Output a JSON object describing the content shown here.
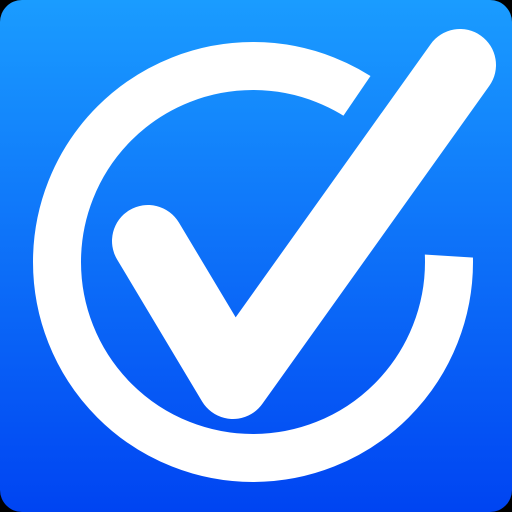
{
  "icon": {
    "name": "check-circle-icon",
    "colors": {
      "gradient_top": "#1a9cff",
      "gradient_bottom": "#0044f2",
      "glyph": "#ffffff",
      "background": "#000000"
    }
  }
}
